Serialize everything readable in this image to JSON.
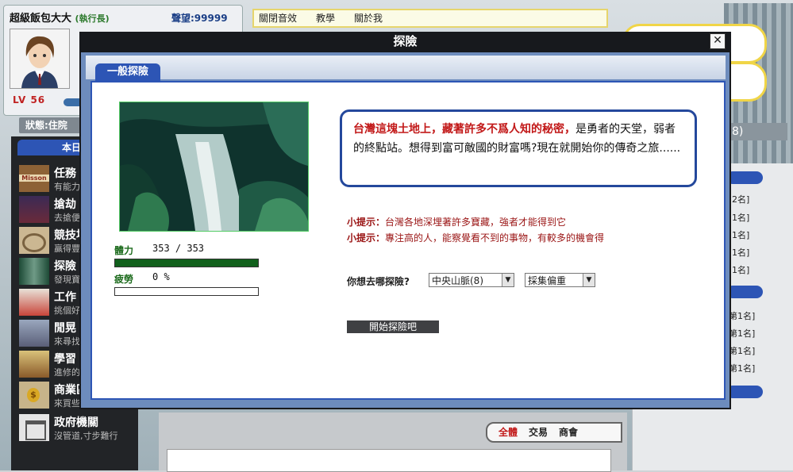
{
  "player": {
    "name": "超級飯包大大",
    "rank": "(執行長)",
    "fame": "聲望:99999",
    "level": "LV 56"
  },
  "status_label": "狀態:住院",
  "topbar": {
    "items": [
      "關閉音效",
      "教學",
      "關於我"
    ]
  },
  "right_tag": "8)",
  "side_menu": {
    "header": "本日行",
    "items": [
      {
        "title": "任務",
        "sub": "有能力",
        "icon": "mission-icon"
      },
      {
        "title": "搶劫",
        "sub": "去搶便",
        "icon": "robbery-icon"
      },
      {
        "title": "競技場",
        "sub": "贏得豐",
        "icon": "arena-icon"
      },
      {
        "title": "探險",
        "sub": "發現寶",
        "icon": "adventure-icon"
      },
      {
        "title": "工作",
        "sub": "挑個好",
        "icon": "work-icon"
      },
      {
        "title": "閒晃",
        "sub": "來尋找",
        "icon": "wander-icon"
      },
      {
        "title": "學習",
        "sub": "進修的",
        "icon": "study-icon"
      },
      {
        "title": "商業區",
        "sub": "來買些",
        "icon": "business-icon"
      },
      {
        "title": "政府機關",
        "sub": "沒管道,寸步難行",
        "icon": "government-icon"
      }
    ]
  },
  "right_ranks": {
    "group1": [
      "2名]",
      "1名]",
      "1名]",
      "1名]",
      "1名]"
    ],
    "group2": [
      "第1名]",
      "第1名]",
      "第1名]",
      "第1名]"
    ]
  },
  "chat_tabs": [
    "全體",
    "交易",
    "商會"
  ],
  "modal": {
    "title": "探險",
    "close": "✕",
    "tab": "一般探險",
    "stats": {
      "hp_label": "體力",
      "hp_value": "353 / 353",
      "hp_fraction": 1.0,
      "fatigue_label": "疲勞",
      "fatigue_value": "0 %",
      "fatigue_fraction": 0.0
    },
    "story_highlight": "台灣這塊土地上，藏著許多不爲人知的秘密，",
    "story_rest": "是勇者的天堂，弱者的終點站。想得到富可敵國的財富嗎?現在就開始你的傳奇之旅......",
    "tips": [
      {
        "label": "小提示：",
        "text": "台灣各地深埋著許多寶藏，強者才能得到它"
      },
      {
        "label": "小提示：",
        "text": "專注高的人，能察覺看不到的事物，有較多的機會得"
      }
    ],
    "question": "你想去哪探險?",
    "location_selected": "中央山脈(8)",
    "mode_selected": "採集偏重",
    "start_button": "開始探險吧"
  }
}
